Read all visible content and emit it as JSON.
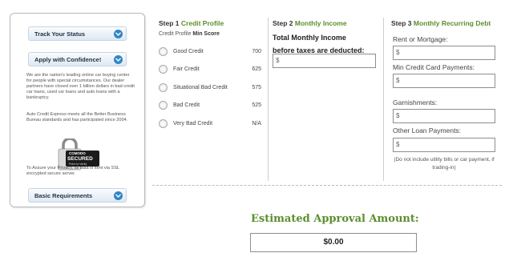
{
  "sidebar": {
    "track_status": "Track Your Status",
    "apply_confidence": "Apply with Confidence!",
    "paragraph1": "We are the nation's leading online car buying center for people with special circumstances. Our dealer partners have closed over 1 billion dollars in bad credit car loans, used car loans and auto loans with a bankruptcy.",
    "paragraph2": "Auto Credit Express meets all the Better Business Bureau standards and has participated since 2004.",
    "seal": {
      "brand": "COMODO",
      "secured": "SECURED",
      "verify": "Point to Verify"
    },
    "privacy": "To Assure your Privacy, all data is sent via SSL encrypted secure server.",
    "basic_requirements": "Basic Requirements"
  },
  "step1": {
    "step": "Step 1",
    "title": "Credit Profile",
    "sub_profile": "Credit Profile",
    "sub_score": "Min Score",
    "options": [
      {
        "label": "Good Credit",
        "score": "700"
      },
      {
        "label": "Fair Credit",
        "score": "625"
      },
      {
        "label": "Situational Bad Credit",
        "score": "575"
      },
      {
        "label": "Bad Credit",
        "score": "525"
      },
      {
        "label": "Very Bad Credit",
        "score": "N/A"
      }
    ]
  },
  "step2": {
    "step": "Step 2",
    "title": "Monthly Income",
    "label_line1": "Total Monthly Income",
    "label_line2": "before taxes are deducted:",
    "value": "$"
  },
  "step3": {
    "step": "Step 3",
    "title": "Monthly Recurring Debt",
    "fields": [
      {
        "label": "Rent or Mortgage:",
        "value": "$"
      },
      {
        "label": "Min Credit Card Payments:",
        "value": "$"
      },
      {
        "label": "Garnishments:",
        "value": "$"
      },
      {
        "label": "Other Loan Payments:",
        "value": "$"
      }
    ],
    "note": "(Do not include utility bills or car payment, if trading-in)"
  },
  "estimate": {
    "title": "Estimated Approval Amount:",
    "value": "$0.00"
  },
  "colors": {
    "green": "#5c8e2d",
    "blue": "#2f86c6"
  }
}
